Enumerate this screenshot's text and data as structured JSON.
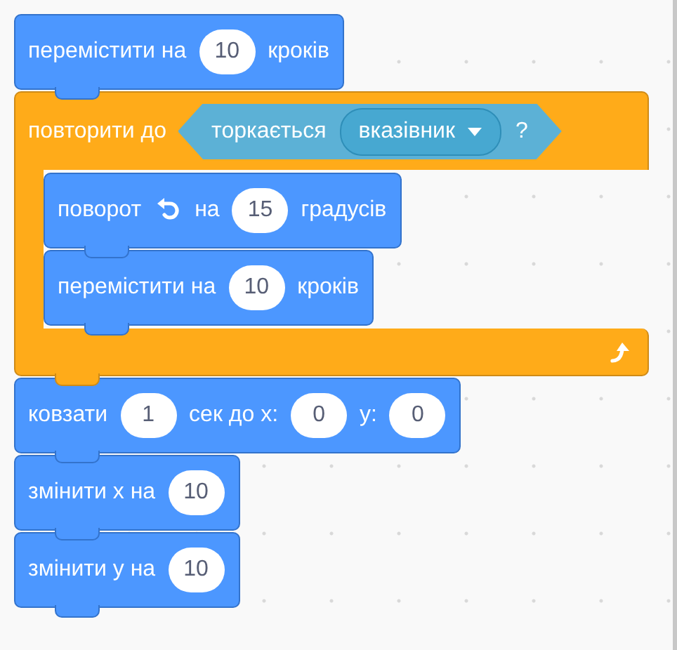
{
  "script": [
    {
      "kind": "motion",
      "parts": [
        {
          "kind": "text",
          "text": "перемістити на"
        },
        {
          "kind": "number",
          "text": "10"
        },
        {
          "kind": "text",
          "text": "кроків"
        }
      ]
    },
    {
      "kind": "repeat-until",
      "label": "повторити до",
      "condition": {
        "text": "торкається",
        "menu": "вказівник",
        "mark": "?"
      },
      "children": [
        {
          "kind": "motion",
          "parts": [
            {
              "kind": "text",
              "text": "поворот"
            },
            {
              "kind": "turn"
            },
            {
              "kind": "text",
              "text": "на"
            },
            {
              "kind": "number",
              "text": "15"
            },
            {
              "kind": "text",
              "text": "градусів"
            }
          ]
        },
        {
          "kind": "motion",
          "parts": [
            {
              "kind": "text",
              "text": "перемістити на"
            },
            {
              "kind": "number",
              "text": "10"
            },
            {
              "kind": "text",
              "text": "кроків"
            }
          ]
        }
      ]
    },
    {
      "kind": "motion",
      "parts": [
        {
          "kind": "text",
          "text": "ковзати"
        },
        {
          "kind": "number",
          "text": "1"
        },
        {
          "kind": "text",
          "text": "сек до x:"
        },
        {
          "kind": "number",
          "text": "0"
        },
        {
          "kind": "text",
          "text": "y:"
        },
        {
          "kind": "number",
          "text": "0"
        }
      ]
    },
    {
      "kind": "motion",
      "parts": [
        {
          "kind": "text",
          "text": "змінити x на"
        },
        {
          "kind": "number",
          "text": "10"
        }
      ]
    },
    {
      "kind": "motion",
      "parts": [
        {
          "kind": "text",
          "text": "змінити y на"
        },
        {
          "kind": "number",
          "text": "10"
        }
      ]
    }
  ]
}
